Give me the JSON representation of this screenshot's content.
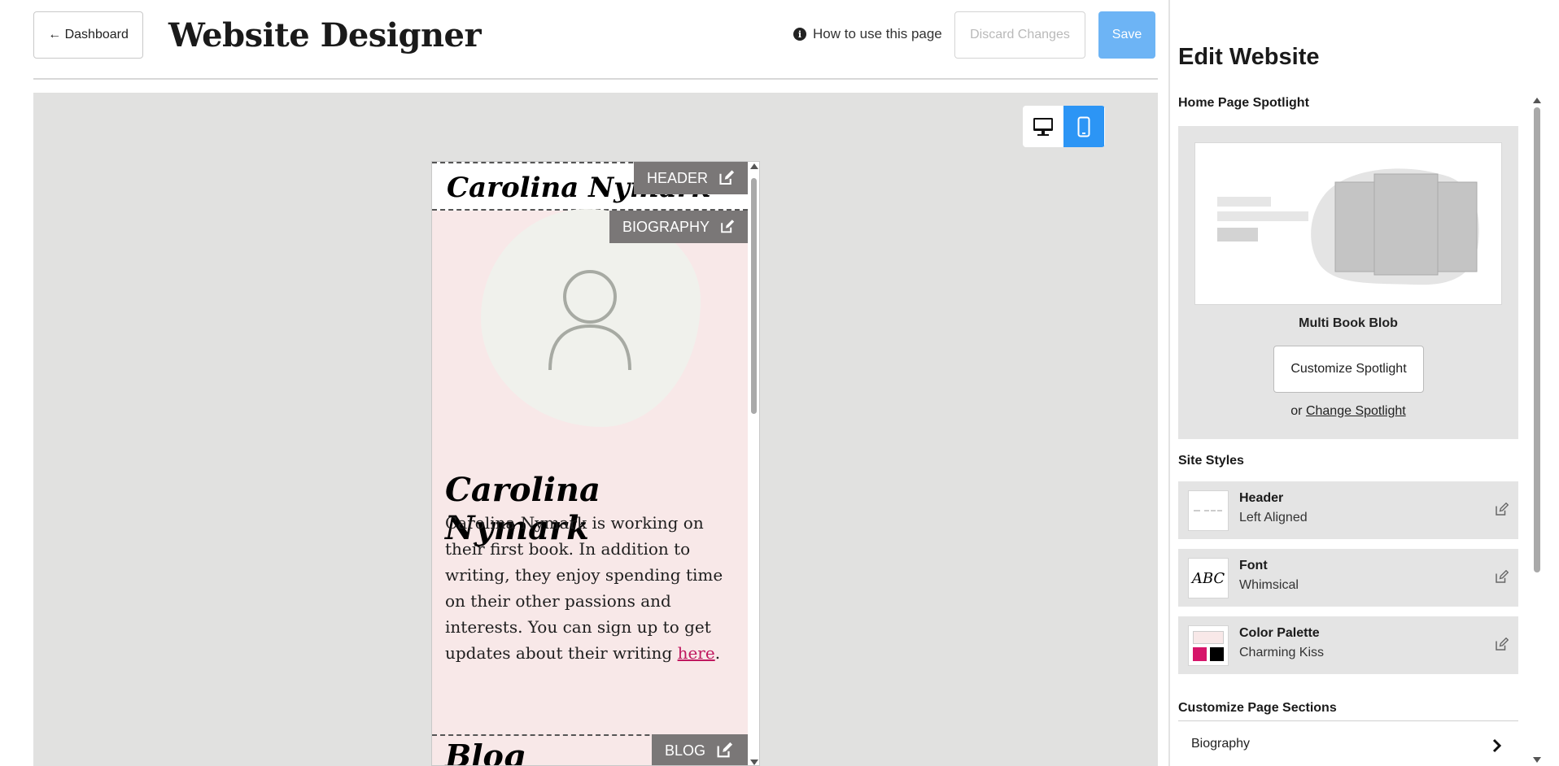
{
  "topbar": {
    "dashboard_label": "← Dashboard",
    "title": "Website Designer",
    "howto_label": "How to use this page",
    "discard_label": "Discard Changes",
    "save_label": "Save"
  },
  "colors": {
    "save_button": "#6db4f5",
    "active_device": "#2c95f5",
    "link": "#c0185f",
    "section_tag": "#7a7777",
    "preview_background": "#f8e8e8"
  },
  "device_toggle": {
    "options": [
      "desktop-icon",
      "mobile-icon"
    ],
    "active": "mobile"
  },
  "preview": {
    "header_name": "Carolina Nymark",
    "tags": {
      "header": "HEADER",
      "biography": "BIOGRAPHY",
      "blog": "BLOG"
    },
    "bio_name": "Carolina Nymark",
    "bio_text": "Carolina Nymark is working on their first book. In addition to writing, they enjoy spending time on their other passions and interests. You can sign up to get updates about their writing ",
    "bio_link": "here",
    "bio_end": ".",
    "blog_title": "Blog"
  },
  "panel": {
    "title": "Edit Website",
    "spotlight": {
      "section_label": "Home Page Spotlight",
      "name": "Multi Book Blob",
      "customize_label": "Customize Spotlight",
      "or_text": "or ",
      "change_label": "Change Spotlight"
    },
    "site_styles": {
      "section_label": "Site Styles",
      "items": [
        {
          "name": "Header",
          "value": "Left Aligned"
        },
        {
          "name": "Font",
          "value": "Whimsical"
        },
        {
          "name": "Color Palette",
          "value": "Charming Kiss"
        }
      ],
      "font_sample": "ABC",
      "palette_swatches": [
        "#f8e8e8",
        "#d6156a",
        "#000000"
      ]
    },
    "sections": {
      "section_label": "Customize Page Sections",
      "items": [
        {
          "label": "Biography"
        }
      ]
    }
  }
}
